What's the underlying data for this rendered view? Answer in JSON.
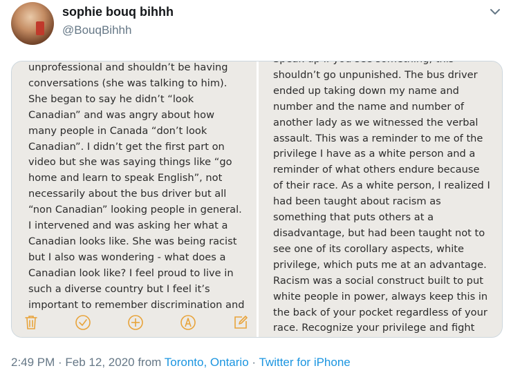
{
  "tweet": {
    "name": "sophie bouq bihhh",
    "handle": "@BouqBihhh",
    "timestamp": "2:49 PM · Feb 12, 2020 from ",
    "location": "Toronto, Ontario",
    "separator": " · ",
    "source": "Twitter for iPhone"
  },
  "media": {
    "left_text": "unprofessional and shouldn’t be having\nconversations (she was talking to him).\nShe began to say he didn’t “look\nCanadian” and was angry about how\nmany people in Canada “don’t look\nCanadian”. I didn’t get the first part on\nvideo but she was saying things like “go\nhome and learn to speak English”, not\nnecessarily about the bus driver but all\n“non Canadian” looking people in general.\nI intervened and was asking her what a\nCanadian looks like. She was being racist\nbut I also was wondering - what does a\nCanadian look like? I feel proud to live in\nsuch a diverse country but I feel it’s\nimportant to remember discrimination and",
    "right_text": "Speak up if you see something, this\nshouldn’t go unpunished. The bus driver\nended up taking down my name and\nnumber and the name and number of\nanother lady as we witnessed the verbal\nassault. This was a reminder to me of the\nprivilege I have as a white person and a\nreminder of what others endure because\nof their race. As a white person, I realized I\nhad been taught about racism as\nsomething that puts others at a\ndisadvantage, but had been taught not to\nsee one of its corollary aspects, white\nprivilege, which puts me at an advantage.\nRacism was a social construct built to put\nwhite people in power, always keep this in\nthe back of your pocket regardless of your\nrace. Recognize your privilege and fight",
    "toolbar_icons": [
      "trash-icon",
      "checkmark-icon",
      "add-icon",
      "markup-icon",
      "compose-icon"
    ]
  },
  "colors": {
    "link": "#1b95e0",
    "secondary_text": "#657786",
    "toolbar_icon": "#e8a33a"
  }
}
